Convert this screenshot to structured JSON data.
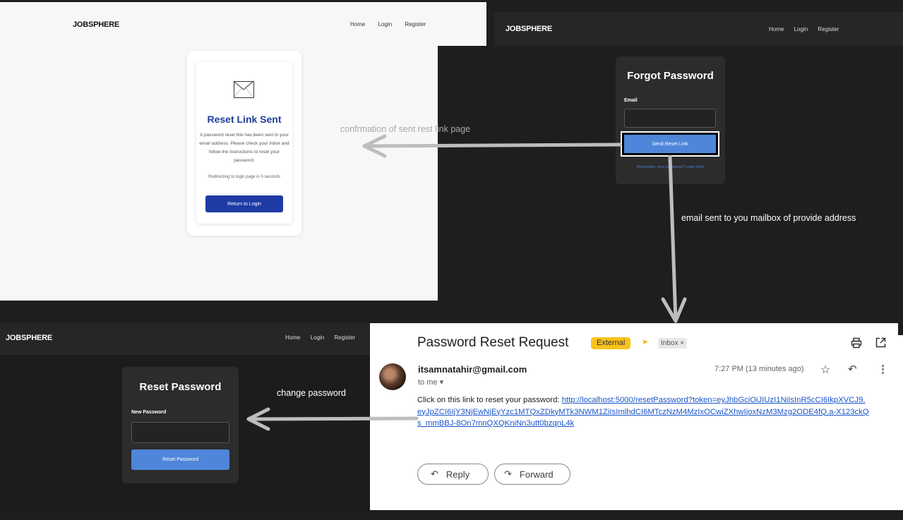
{
  "confirm_page": {
    "brand": "JOBSPHERE",
    "nav": [
      "Home",
      "Login",
      "Register"
    ],
    "title": "Reset Link Sent",
    "message": "A password reset link has been sent to your email address. Please check your inbox and follow the instructions to reset your password.",
    "redirect": "Redirecting to login page in 5 seconds",
    "button": "Return to Login",
    "icon": "envelope-icon"
  },
  "forgot_page": {
    "brand": "JOBSPHERE",
    "nav": [
      "Home",
      "Login",
      "Register"
    ],
    "title": "Forgot Password",
    "email_label": "Email",
    "email_value": "",
    "button": "Send Reset Link",
    "footer_link": "Remember your password? Login here"
  },
  "reset_page": {
    "brand": "JOBSPHERE",
    "nav": [
      "Home",
      "Login",
      "Register"
    ],
    "title": "Reset Password",
    "password_label": "New Password",
    "password_value": "",
    "button": "Reset Password"
  },
  "email": {
    "subject": "Password Reset Request",
    "external_badge": "External",
    "inbox_label": "Inbox ×",
    "from": "itsamnatahir@gmail.com",
    "to": "to me ▾",
    "time": "7:27 PM (13 minutes ago)",
    "body_prefix": "Click on this link to reset your password:",
    "link": "http://localhost:5000/resetPassword?token=eyJhbGciOiJIUzI1NiIsInR5cCI6IkpXVCJ9.eyJpZCI6IjY3NjEwNjEyYzc1MTQxZDkyMTk3NWM1ZiIsImlhdCI6MTczNzM4MzIxOCwiZXhwIjoxNzM3Mzg2ODE4fQ.a-X123ckQs_mmBBJ-8On7mnQXQKniNn3utt0bzqnL4k",
    "reply_label": "Reply",
    "forward_label": "Forward"
  },
  "annotations": {
    "confirmation": "confrmation of sent rest link page",
    "email_sent": "email sent to you mailbox of provide address",
    "change_password": "change password"
  },
  "colors": {
    "primary_blue": "#1e3aa5",
    "button_blue": "#4f86d9",
    "dark_bg": "#1e1e1e",
    "arrow_gray": "#bdbdbd",
    "external_yellow": "#f9c21c"
  }
}
